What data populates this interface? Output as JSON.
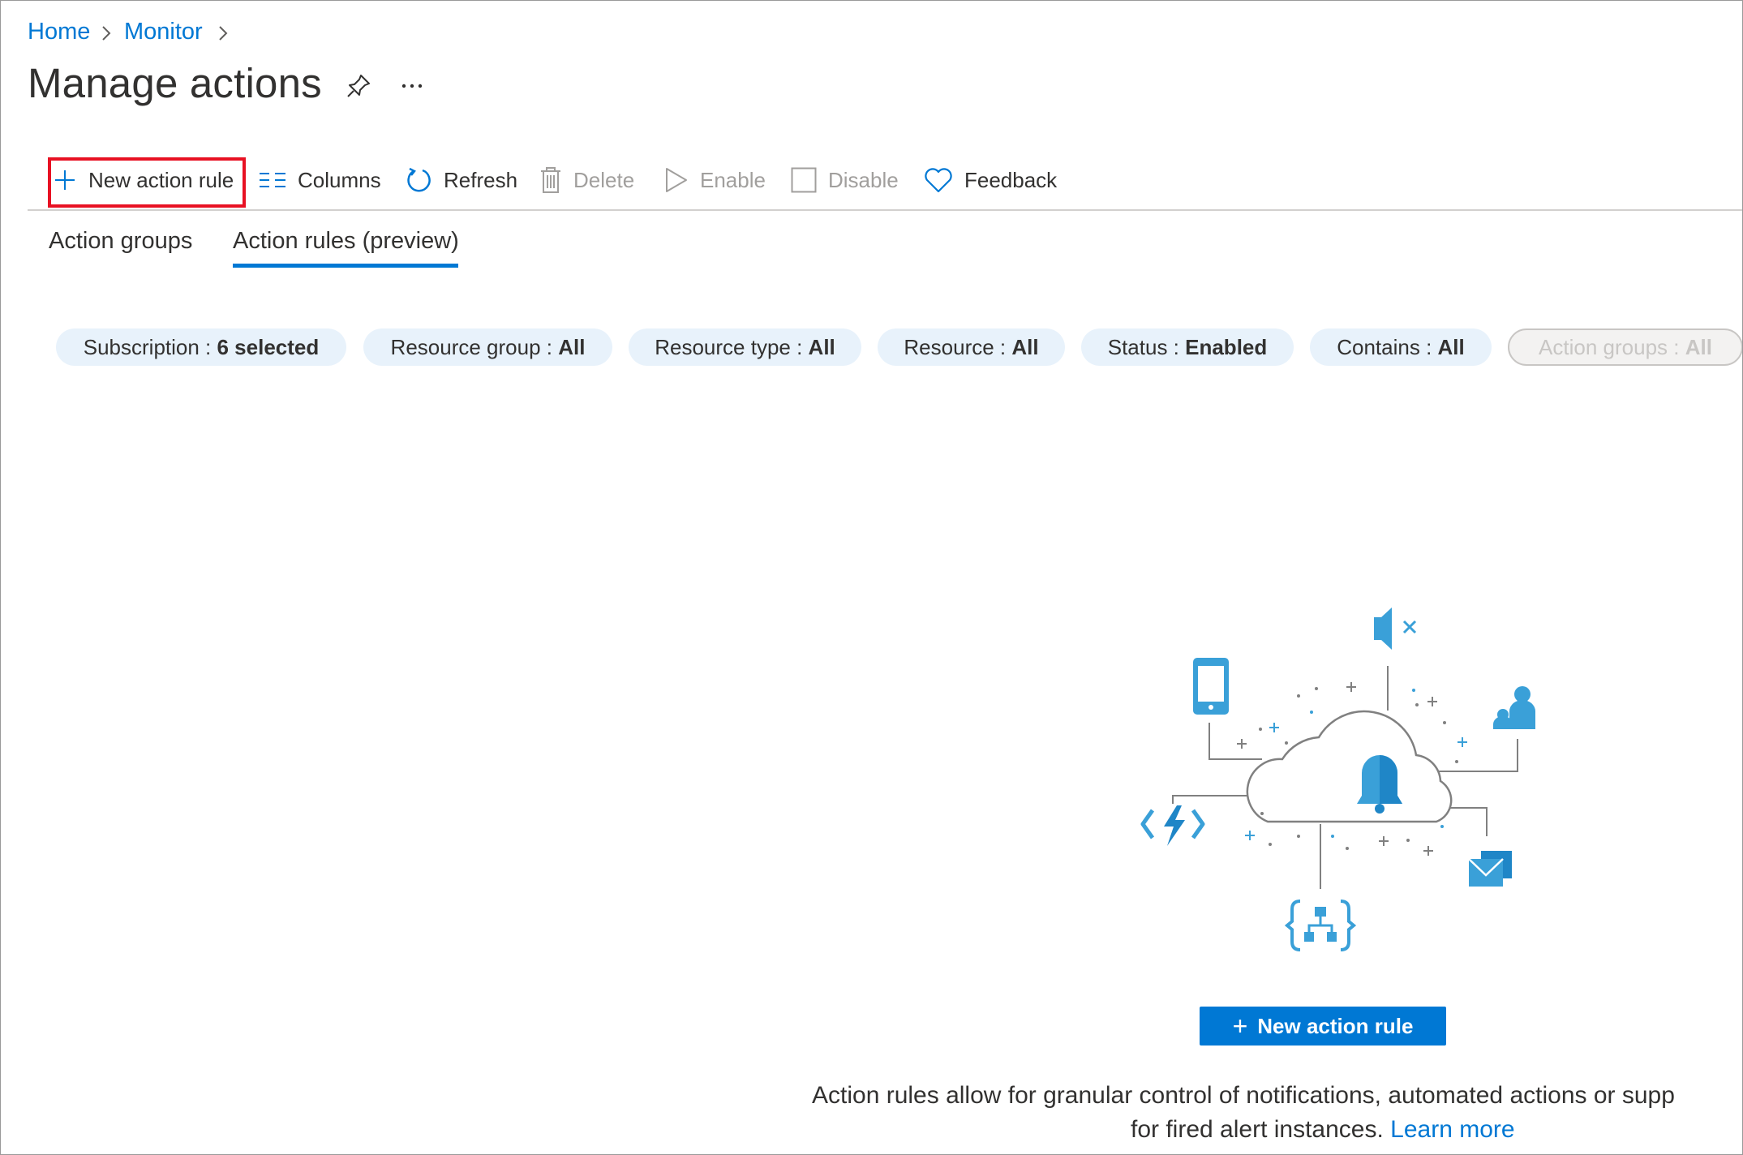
{
  "breadcrumb": {
    "home": "Home",
    "monitor": "Monitor"
  },
  "page": {
    "title": "Manage actions"
  },
  "toolbar": {
    "new_action_rule": "New action rule",
    "columns": "Columns",
    "refresh": "Refresh",
    "delete": "Delete",
    "enable": "Enable",
    "disable": "Disable",
    "feedback": "Feedback"
  },
  "tabs": [
    {
      "label": "Action groups",
      "active": false
    },
    {
      "label": "Action rules (preview)",
      "active": true
    }
  ],
  "filters": [
    {
      "key": "Subscription",
      "value": "6 selected",
      "enabled": true
    },
    {
      "key": "Resource group",
      "value": "All",
      "enabled": true
    },
    {
      "key": "Resource type",
      "value": "All",
      "enabled": true
    },
    {
      "key": "Resource",
      "value": "All",
      "enabled": true
    },
    {
      "key": "Status",
      "value": "Enabled",
      "enabled": true
    },
    {
      "key": "Contains",
      "value": "All",
      "enabled": true
    },
    {
      "key": "Action groups",
      "value": "All",
      "enabled": false
    }
  ],
  "empty_state": {
    "button_label": "New action rule",
    "description_line1": "Action rules allow for granular control of notifications, automated actions or supp",
    "description_line2": "for fired alert instances.",
    "learn_more": "Learn more"
  },
  "colors": {
    "accent": "#0078d4",
    "highlight": "#e81123",
    "icon_blue": "#3aa0d8"
  }
}
